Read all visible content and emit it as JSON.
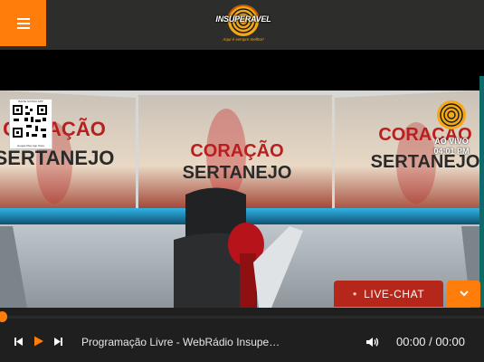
{
  "header": {
    "menu_icon": "hamburger-icon",
    "logo": {
      "brand": "INSUPERAVEL",
      "tagline": "Aqui é sempre melhor!"
    }
  },
  "video": {
    "scene_text": [
      "CORAÇÃO",
      "SERTANEJO"
    ],
    "qr": {
      "caption": "BAIXE NOSSO APP",
      "stores": "Google Play  App Store"
    },
    "live_badge": {
      "status": "AO VIVO",
      "time": "04:01 PM"
    }
  },
  "live_chat": {
    "label": "LIVE-CHAT",
    "collapse_icon": "chevron-down-icon"
  },
  "player": {
    "progress": 0,
    "title": "Programação Livre - WebRádio Insuperável",
    "current_time": "00:00",
    "duration": "00:00",
    "time_sep": " / ",
    "colors": {
      "accent": "#ff7d0a",
      "chat": "#b5261b"
    }
  }
}
